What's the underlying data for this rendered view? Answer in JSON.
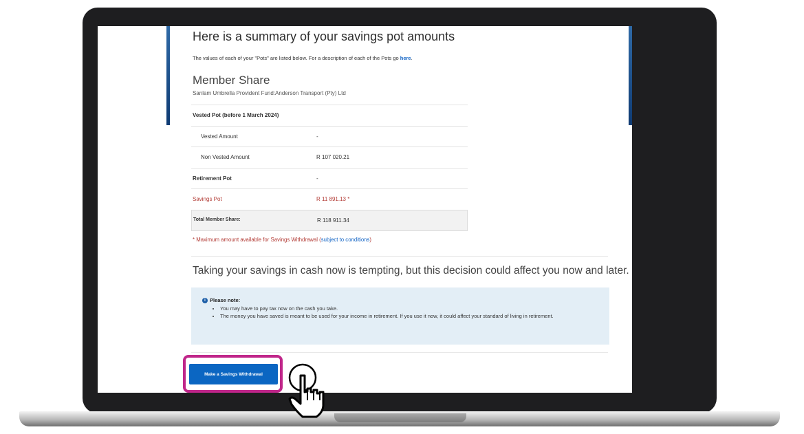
{
  "page": {
    "title": "Here is a summary of your savings pot amounts",
    "intro_text": "The values of each of your \"Pots\" are listed below. For a description of each of the Pots go",
    "intro_link": "here",
    "intro_end": "."
  },
  "member_share": {
    "title": "Member Share",
    "fund_name": "Sanlam Umbrella Provident Fund:Anderson Transport (Pty) Ltd",
    "rows": [
      {
        "label": "Vested Pot (before 1 March 2024)",
        "value": ""
      },
      {
        "label": "Vested Amount",
        "value": "-"
      },
      {
        "label": "Non Vested Amount",
        "value": "R 107 020.21"
      },
      {
        "label": "Retirement Pot",
        "value": "-"
      },
      {
        "label": "Savings Pot",
        "value": "R 11 891.13 *"
      },
      {
        "label": "Total Member Share:",
        "value": "R 118 911.34"
      }
    ],
    "footnote_text": "* Maximum amount available for Savings Withdrawal (",
    "footnote_link": "subject to conditions",
    "footnote_end": ")"
  },
  "warning": {
    "heading": "Taking your savings in cash now is tempting, but this decision could affect you now and later.",
    "note_title": "Please note:",
    "note_items": [
      "You may have to pay tax now on the cash you take.",
      "The money you have saved is meant to be used for your income in retirement. If you use it now, it could affect your standard of living in retirement."
    ]
  },
  "actions": {
    "withdraw_button": "Make a Savings Withdrawal"
  },
  "colors": {
    "accent_blue": "#0b66c2",
    "link_blue": "#0f62c4",
    "savings_red": "#b23a34",
    "highlight_magenta": "#c0268a",
    "note_bg": "#e3eef6"
  },
  "icons": {
    "info": "info-icon",
    "cursor": "hand-pointer-icon"
  }
}
